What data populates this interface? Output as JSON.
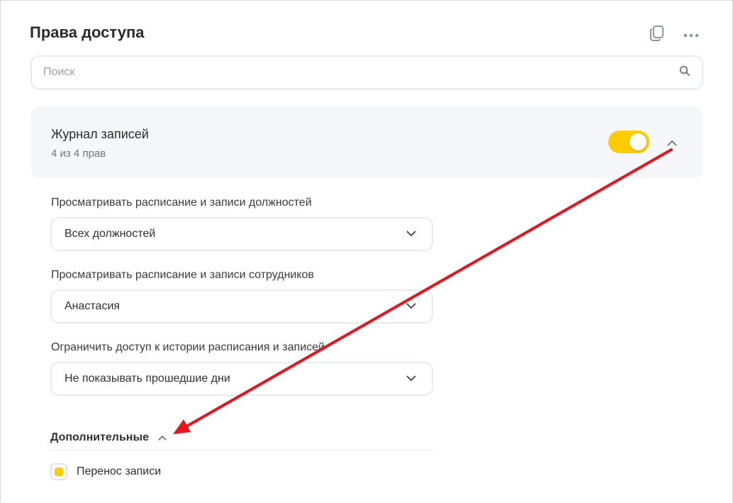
{
  "page": {
    "title": "Права доступа"
  },
  "search": {
    "placeholder": "Поиск"
  },
  "section": {
    "title": "Журнал записей",
    "subtitle": "4 из 4 прав",
    "enabled": true
  },
  "fields": [
    {
      "label": "Просматривать расписание и записи должностей",
      "value": "Всех должностей"
    },
    {
      "label": "Просматривать расписание и записи сотрудников",
      "value": "Анастасия"
    },
    {
      "label": "Ограничить доступ к истории расписания и записей",
      "value": "Не показывать прошедшие дни"
    }
  ],
  "extra": {
    "title": "Дополнительные",
    "items": [
      {
        "label": "Перенос записи",
        "checked": true
      }
    ]
  },
  "colors": {
    "accent": "#FFCC00",
    "annotation_arrow": "#E8141B"
  },
  "icons": {
    "copy": "copy-icon",
    "more": "more-horizontal-icon",
    "search": "search-icon",
    "chevron_up": "chevron-up-icon",
    "chevron_down": "chevron-down-icon"
  }
}
